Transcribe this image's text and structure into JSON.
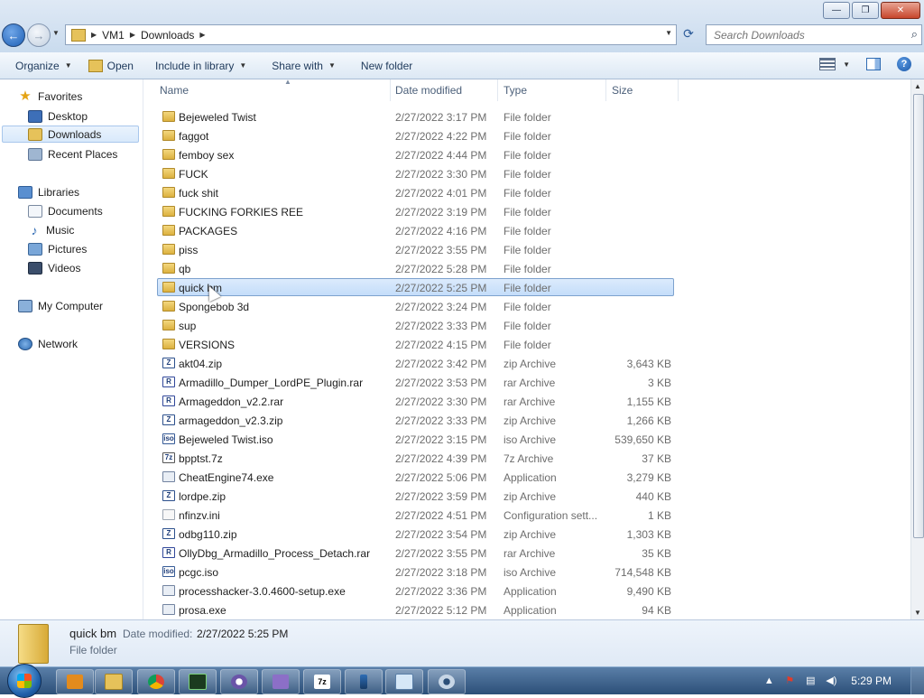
{
  "window": {
    "minimize_glyph": "—",
    "maximize_glyph": "❐",
    "close_glyph": "✕"
  },
  "nav": {
    "back_glyph": "←",
    "forward_glyph": "→"
  },
  "address": {
    "crumbs": [
      "VM1",
      "Downloads"
    ]
  },
  "search": {
    "placeholder": "Search Downloads"
  },
  "toolbar": {
    "organize": "Organize",
    "open": "Open",
    "include_in_library": "Include in library",
    "share_with": "Share with",
    "new_folder": "New folder",
    "help": "?"
  },
  "navpane": {
    "favorites": "Favorites",
    "desktop": "Desktop",
    "downloads": "Downloads",
    "recent_places": "Recent Places",
    "libraries": "Libraries",
    "documents": "Documents",
    "music": "Music",
    "pictures": "Pictures",
    "videos": "Videos",
    "my_computer": "My Computer",
    "network": "Network"
  },
  "columns": {
    "name": "Name",
    "date_modified": "Date modified",
    "type": "Type",
    "size": "Size"
  },
  "files": [
    {
      "name": "Bejeweled Twist",
      "date": "2/27/2022 3:17 PM",
      "type": "File folder",
      "size": "",
      "icon": "folder"
    },
    {
      "name": "faggot",
      "date": "2/27/2022 4:22 PM",
      "type": "File folder",
      "size": "",
      "icon": "folder"
    },
    {
      "name": "femboy sex",
      "date": "2/27/2022 4:44 PM",
      "type": "File folder",
      "size": "",
      "icon": "folder"
    },
    {
      "name": "FUCK",
      "date": "2/27/2022 3:30 PM",
      "type": "File folder",
      "size": "",
      "icon": "folder"
    },
    {
      "name": "fuck shit",
      "date": "2/27/2022 4:01 PM",
      "type": "File folder",
      "size": "",
      "icon": "folder"
    },
    {
      "name": "FUCKING FORKIES REE",
      "date": "2/27/2022 3:19 PM",
      "type": "File folder",
      "size": "",
      "icon": "folder"
    },
    {
      "name": "PACKAGES",
      "date": "2/27/2022 4:16 PM",
      "type": "File folder",
      "size": "",
      "icon": "folder"
    },
    {
      "name": "piss",
      "date": "2/27/2022 3:55 PM",
      "type": "File folder",
      "size": "",
      "icon": "folder"
    },
    {
      "name": "qb",
      "date": "2/27/2022 5:28 PM",
      "type": "File folder",
      "size": "",
      "icon": "folder"
    },
    {
      "name": "quick bm",
      "date": "2/27/2022 5:25 PM",
      "type": "File folder",
      "size": "",
      "icon": "folder",
      "selected": true
    },
    {
      "name": "Spongebob 3d",
      "date": "2/27/2022 3:24 PM",
      "type": "File folder",
      "size": "",
      "icon": "folder"
    },
    {
      "name": "sup",
      "date": "2/27/2022 3:33 PM",
      "type": "File folder",
      "size": "",
      "icon": "folder"
    },
    {
      "name": "VERSIONS",
      "date": "2/27/2022 4:15 PM",
      "type": "File folder",
      "size": "",
      "icon": "folder"
    },
    {
      "name": "akt04.zip",
      "date": "2/27/2022 3:42 PM",
      "type": "zip Archive",
      "size": "3,643 KB",
      "icon": "zip"
    },
    {
      "name": "Armadillo_Dumper_LordPE_Plugin.rar",
      "date": "2/27/2022 3:53 PM",
      "type": "rar Archive",
      "size": "3 KB",
      "icon": "rar"
    },
    {
      "name": "Armageddon_v2.2.rar",
      "date": "2/27/2022 3:30 PM",
      "type": "rar Archive",
      "size": "1,155 KB",
      "icon": "rar"
    },
    {
      "name": "armageddon_v2.3.zip",
      "date": "2/27/2022 3:33 PM",
      "type": "zip Archive",
      "size": "1,266 KB",
      "icon": "zip"
    },
    {
      "name": "Bejeweled Twist.iso",
      "date": "2/27/2022 3:15 PM",
      "type": "iso Archive",
      "size": "539,650 KB",
      "icon": "iso"
    },
    {
      "name": "bpptst.7z",
      "date": "2/27/2022 4:39 PM",
      "type": "7z Archive",
      "size": "37 KB",
      "icon": "sevenz"
    },
    {
      "name": "CheatEngine74.exe",
      "date": "2/27/2022 5:06 PM",
      "type": "Application",
      "size": "3,279 KB",
      "icon": "exe"
    },
    {
      "name": "lordpe.zip",
      "date": "2/27/2022 3:59 PM",
      "type": "zip Archive",
      "size": "440 KB",
      "icon": "zip"
    },
    {
      "name": "nfinzv.ini",
      "date": "2/27/2022 4:51 PM",
      "type": "Configuration sett...",
      "size": "1 KB",
      "icon": "ini"
    },
    {
      "name": "odbg110.zip",
      "date": "2/27/2022 3:54 PM",
      "type": "zip Archive",
      "size": "1,303 KB",
      "icon": "zip"
    },
    {
      "name": "OllyDbg_Armadillo_Process_Detach.rar",
      "date": "2/27/2022 3:55 PM",
      "type": "rar Archive",
      "size": "35 KB",
      "icon": "rar"
    },
    {
      "name": "pcgc.iso",
      "date": "2/27/2022 3:18 PM",
      "type": "iso Archive",
      "size": "714,548 KB",
      "icon": "iso"
    },
    {
      "name": "processhacker-3.0.4600-setup.exe",
      "date": "2/27/2022 3:36 PM",
      "type": "Application",
      "size": "9,490 KB",
      "icon": "exe"
    },
    {
      "name": "prosa.exe",
      "date": "2/27/2022 5:12 PM",
      "type": "Application",
      "size": "94 KB",
      "icon": "exe"
    }
  ],
  "icon_glyphs": {
    "zip": "Z",
    "rar": "R",
    "iso": "iso",
    "sevenz": "7z",
    "exe": "",
    "ini": "",
    "folder": ""
  },
  "details": {
    "name": "quick bm",
    "date_label": "Date modified:",
    "date_value": "2/27/2022 5:25 PM",
    "type": "File folder"
  },
  "taskbar": {
    "clock": "5:29 PM",
    "apps": [
      "media-player",
      "file-explorer",
      "chrome",
      "terminal",
      "tool-gear",
      "editor",
      "7zip",
      "pen-tool",
      "notepad",
      "settings-gear"
    ],
    "sevenzip_label": "7z"
  },
  "colors": {
    "selection": "#c4ddfa",
    "accent": "#1d5fb5"
  }
}
